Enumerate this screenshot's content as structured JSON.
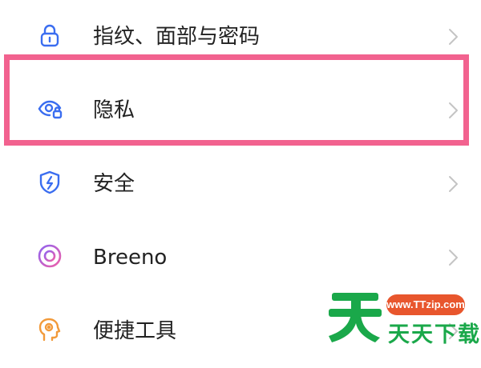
{
  "settings_list": {
    "items": [
      {
        "label": "指纹、面部与密码",
        "icon": "lock-icon",
        "icon_color": "#3a6df0"
      },
      {
        "label": "隐私",
        "icon": "privacy-eye-icon",
        "icon_color": "#3a6df0"
      },
      {
        "label": "安全",
        "icon": "security-shield-icon",
        "icon_color": "#3a6df0"
      },
      {
        "label": "Breeno",
        "icon": "breeno-icon",
        "icon_color": "#c05ce0"
      },
      {
        "label": "便捷工具",
        "icon": "convenience-tools-icon",
        "icon_color": "#f29a3a"
      }
    ],
    "highlighted_item": "隐私",
    "highlight_color": "#f2628f",
    "chevron_icon": "chevron-right-icon"
  },
  "watermark": {
    "logo_text": "天",
    "url": "www.TTzip.com",
    "name": "天天下载",
    "colors": {
      "green": "#1aa84a",
      "orange": "#e8562d"
    }
  }
}
